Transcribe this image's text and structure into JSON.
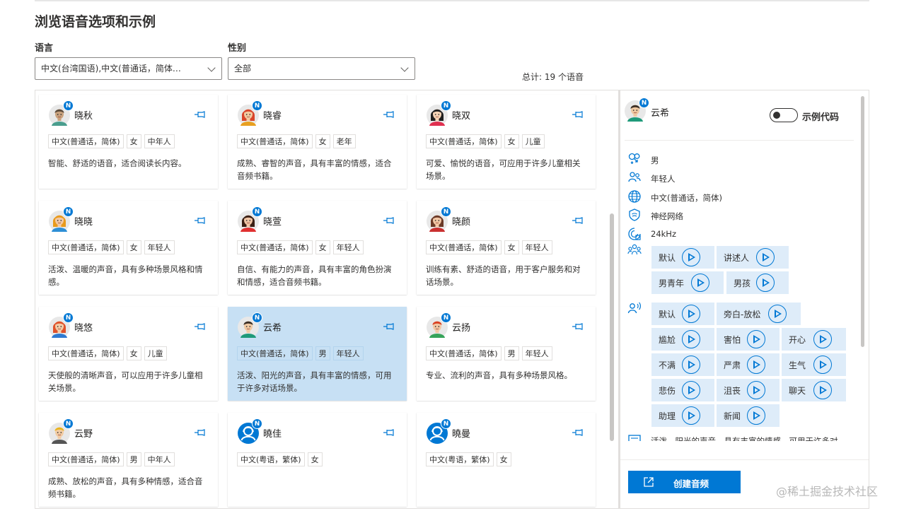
{
  "page_title": "浏览语音选项和示例",
  "filters": {
    "language_label": "语言",
    "language_value": "中文(台湾国语),中文(普通话，简体…",
    "gender_label": "性别",
    "gender_value": "全部"
  },
  "total": "总计: 19 个语音",
  "badge": "N",
  "cards": [
    {
      "name": "晓秋",
      "tags": [
        "中文(普通话，简体)",
        "女",
        "中年人"
      ],
      "desc": "智能、舒适的语音，适合阅读长内容。",
      "avatar": "female-short"
    },
    {
      "name": "晓睿",
      "tags": [
        "中文(普通话，简体)",
        "女",
        "老年"
      ],
      "desc": "成熟、睿智的声音，具有丰富的情感，适合音频书籍。",
      "avatar": "female-red"
    },
    {
      "name": "晓双",
      "tags": [
        "中文(普通话，简体)",
        "女",
        "儿童"
      ],
      "desc": "可爱、愉悦的语音，可应用于许多儿童相关场景。",
      "avatar": "girl"
    },
    {
      "name": "晓晓",
      "tags": [
        "中文(普通话，简体)",
        "女",
        "年轻人"
      ],
      "desc": "活泼、温暖的声音，具有多种场景风格和情感。",
      "avatar": "female-orange"
    },
    {
      "name": "晓萱",
      "tags": [
        "中文(普通话，简体)",
        "女",
        "年轻人"
      ],
      "desc": "自信、有能力的声音，具有丰富的角色扮演和情感，适合音频书籍。",
      "avatar": "female-dark"
    },
    {
      "name": "晓颜",
      "tags": [
        "中文(普通话，简体)",
        "女",
        "年轻人"
      ],
      "desc": "训练有素、舒适的语音，用于客户服务和对话场景。",
      "avatar": "female-brown"
    },
    {
      "name": "晓悠",
      "tags": [
        "中文(普通话，简体)",
        "女",
        "儿童"
      ],
      "desc": "天使般的清晰声音，可以应用于许多儿童相关场景。",
      "avatar": "girl-blue"
    },
    {
      "name": "云希",
      "tags": [
        "中文(普通话，简体)",
        "男",
        "年轻人"
      ],
      "desc": "活泼、阳光的声音，具有丰富的情感，可用于许多对话场景。",
      "avatar": "male-young",
      "selected": true
    },
    {
      "name": "云扬",
      "tags": [
        "中文(普通话，简体)",
        "男",
        "年轻人"
      ],
      "desc": "专业、流利的声音，具有多种场景风格。",
      "avatar": "male-red"
    },
    {
      "name": "云野",
      "tags": [
        "中文(普通话，简体)",
        "男",
        "中年人"
      ],
      "desc": "成熟、放松的声音，具有多种情感，适合音频书籍。",
      "avatar": "male-yellow"
    },
    {
      "name": "曉佳",
      "tags": [
        "中文(粤语，繁体)",
        "女"
      ],
      "desc": "",
      "avatar": "generic"
    },
    {
      "name": "曉曼",
      "tags": [
        "中文(粤语，繁体)",
        "女"
      ],
      "desc": "",
      "avatar": "generic"
    }
  ],
  "detail": {
    "name": "云希",
    "toggle_label": "示例代码",
    "gender": "男",
    "age": "年轻人",
    "locale": "中文(普通话，简体)",
    "type": "神经网络",
    "rate": "24kHz",
    "roles": [
      "默认",
      "讲述人",
      "男青年",
      "男孩"
    ],
    "styles": [
      "默认",
      "旁白-放松",
      "尴尬",
      "害怕",
      "开心",
      "不满",
      "严肃",
      "生气",
      "悲伤",
      "沮丧",
      "聊天",
      "助理",
      "新闻"
    ],
    "description_cut": "活泼、阳光的声音，具有丰富的情感，可用于许多对",
    "create_button": "创建音频"
  },
  "watermark": "@稀土掘金技术社区",
  "colors": {
    "accent": "#0078d4",
    "selected_card": "#c7e0f4",
    "chip": "#deecf9"
  }
}
